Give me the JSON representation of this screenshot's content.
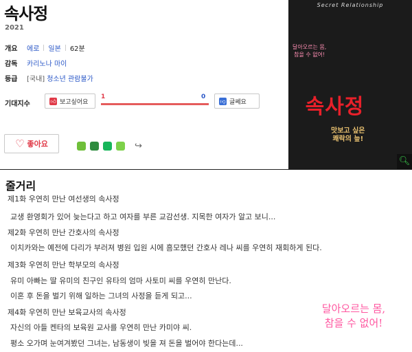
{
  "title": "속사정",
  "year": "2021",
  "info": {
    "genre_label": "개요",
    "genre": "에로",
    "country": "일본",
    "runtime": "62분",
    "director_label": "감독",
    "director": "카리노나 마이",
    "rating_label": "등급",
    "rating_prefix": "[국내]",
    "rating": "청소년 관람불가"
  },
  "expectation": {
    "label": "기대지수",
    "want_label": "보고싶어요",
    "nowant_label": "글쎄요",
    "want_count": "1",
    "nowant_count": "0",
    "want_ratio": 1.0
  },
  "like_label": "좋아요",
  "poster": {
    "header": "Secret Relationship",
    "title": "속사정",
    "tagline1": "달아오르는 몸,\n참을 수 없어!",
    "tagline2": "맛보고 싶은\n쾌락의 늪!"
  },
  "synopsis": {
    "title": "줄거리",
    "episodes": [
      {
        "heading": "제1화 우연히 만난 여선생의 속사정",
        "lines": [
          "교생 환영회가 있어 늦는다고 하고 여자를 부른 교감선생. 지목한 여자가 알고 보니..."
        ]
      },
      {
        "heading": "제2화 우연히 만난 간호사의 속사정",
        "lines": [
          "이치카와는 예전에 다리가 부러져 병원 입원 시에 흠모했던 간호사 레나 씨를 우연히 재회하게 된다."
        ]
      },
      {
        "heading": "제3화 우연히 만난 학부모의 속사정",
        "lines": [
          "유미 아빠는 딸 유미의 친구인 유타의 엄마 사토미 씨를 우연히 만난다.",
          "이혼 후 돈을 벌기 위해 일하는 그녀의 사정을 듣게 되고..."
        ]
      },
      {
        "heading": "제4화 우연히 만난 보육교사의 속사정",
        "lines": [
          "자신의 아들 켄타의 보육원 교사를 우연히 만난 카미야 씨.",
          "평소 오가며 눈여겨봤던 그녀는, 남동생이 빚을 져 돈을 벌어야 한다는데..."
        ]
      }
    ]
  },
  "overlay_text_1": "달아오르는 몸,",
  "overlay_text_2": "참을 수 없어!"
}
